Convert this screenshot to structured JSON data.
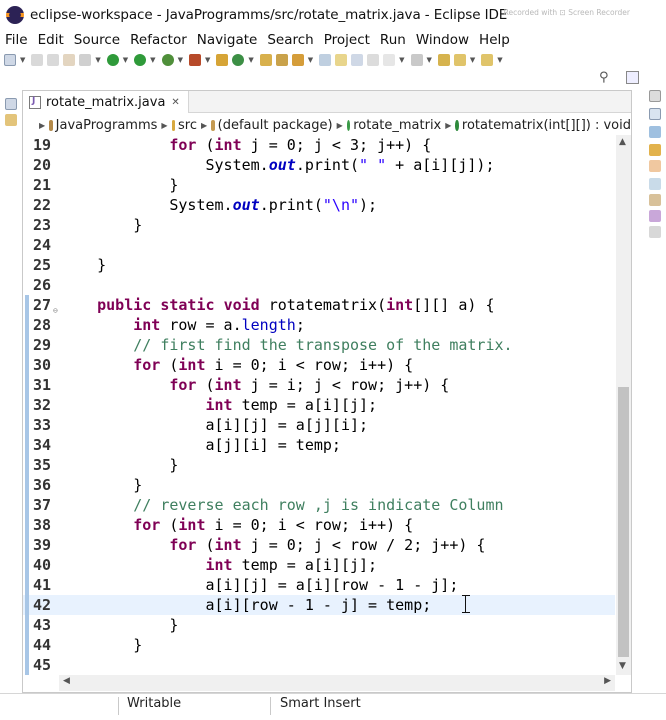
{
  "window": {
    "title": "eclipse-workspace - JavaProgramms/src/rotate_matrix.java - Eclipse IDE",
    "watermark": "Recorded with ⊡ Screen Recorder"
  },
  "menu": [
    "File",
    "Edit",
    "Source",
    "Refactor",
    "Navigate",
    "Search",
    "Project",
    "Run",
    "Window",
    "Help"
  ],
  "editor": {
    "tab_label": "rotate_matrix.java",
    "tab_close": "✕",
    "breadcrumb": [
      {
        "label": "JavaProgramms",
        "icon": "project-icon"
      },
      {
        "label": "src",
        "icon": "source-folder-icon"
      },
      {
        "label": "(default package)",
        "icon": "package-icon"
      },
      {
        "label": "rotate_matrix",
        "icon": "class-icon"
      },
      {
        "label": "rotatematrix(int[][]) : void",
        "icon": "method-icon"
      }
    ],
    "current_line": 42,
    "lines": [
      {
        "num": "19",
        "text": "            for (int j = 0; j < 3; j++) {"
      },
      {
        "num": "20",
        "text": "                System.out.print(\" \" + a[i][j]);"
      },
      {
        "num": "21",
        "text": "            }"
      },
      {
        "num": "22",
        "text": "            System.out.print(\"\\n\");"
      },
      {
        "num": "23",
        "text": "        }"
      },
      {
        "num": "24",
        "text": ""
      },
      {
        "num": "25",
        "text": "    }"
      },
      {
        "num": "26",
        "text": ""
      },
      {
        "num": "27",
        "text": "    public static void rotatematrix(int[][] a) {"
      },
      {
        "num": "28",
        "text": "        int row = a.length;"
      },
      {
        "num": "29",
        "text": "        // first find the transpose of the matrix."
      },
      {
        "num": "30",
        "text": "        for (int i = 0; i < row; i++) {"
      },
      {
        "num": "31",
        "text": "            for (int j = i; j < row; j++) {"
      },
      {
        "num": "32",
        "text": "                int temp = a[i][j];"
      },
      {
        "num": "33",
        "text": "                a[i][j] = a[j][i];"
      },
      {
        "num": "34",
        "text": "                a[j][i] = temp;"
      },
      {
        "num": "35",
        "text": "            }"
      },
      {
        "num": "36",
        "text": "        }"
      },
      {
        "num": "37",
        "text": "        // reverse each row ,j is indicate Column"
      },
      {
        "num": "38",
        "text": "        for (int i = 0; i < row; i++) {"
      },
      {
        "num": "39",
        "text": "            for (int j = 0; j < row / 2; j++) {"
      },
      {
        "num": "40",
        "text": "                int temp = a[i][j];"
      },
      {
        "num": "41",
        "text": "                a[i][j] = a[i][row - 1 - j];"
      },
      {
        "num": "42",
        "text": "                a[i][row - 1 - j] = temp;"
      },
      {
        "num": "43",
        "text": "            }"
      },
      {
        "num": "44",
        "text": "        }"
      },
      {
        "num": "45",
        "text": ""
      }
    ]
  },
  "status": {
    "writable": "Writable",
    "insert_mode": "Smart Insert"
  },
  "colors": {
    "keyword": "#7f0055",
    "field": "#0000c0",
    "string": "#2a00ff",
    "comment": "#3f7f5f",
    "current_line": "#e8f2fe"
  }
}
